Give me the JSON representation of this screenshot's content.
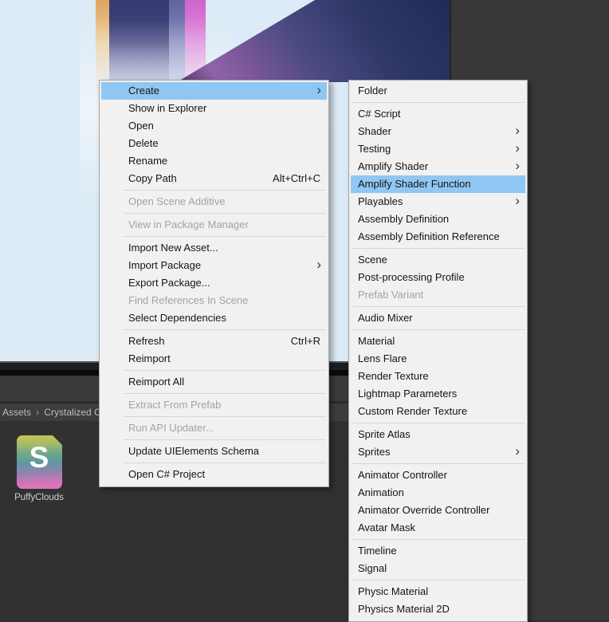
{
  "colors": {
    "scene_bg": "#dcebf6",
    "panel": "#383838",
    "menu_bg": "#f1f1f1",
    "menu_border": "#a5a5a5",
    "menu_text": "#141414",
    "menu_disabled": "#a3a3a3",
    "menu_sep": "#d7d7d7",
    "highlight": "#8fc7f2",
    "breadcrumb_bg": "#3d3d3d",
    "breadcrumb_text": "#bdbdbd",
    "project_bg": "#313131",
    "icon_yellow": "#c9c552",
    "icon_teal": "#5f98a1",
    "icon_pink": "#d873b8"
  },
  "project": {
    "breadcrumb_root": "Assets",
    "breadcrumb_separator": "›",
    "breadcrumb_folder": "Crystalized C",
    "asset": {
      "badge": "S",
      "label": "PuffyClouds"
    }
  },
  "menus": {
    "context": {
      "items": [
        {
          "label": "Create",
          "highlighted": true,
          "submenu": true
        },
        {
          "label": "Show in Explorer"
        },
        {
          "label": "Open"
        },
        {
          "label": "Delete"
        },
        {
          "label": "Rename"
        },
        {
          "label": "Copy Path",
          "shortcut": "Alt+Ctrl+C"
        },
        {
          "separator": true
        },
        {
          "label": "Open Scene Additive",
          "disabled": true
        },
        {
          "separator": true
        },
        {
          "label": "View in Package Manager",
          "disabled": true
        },
        {
          "separator": true
        },
        {
          "label": "Import New Asset..."
        },
        {
          "label": "Import Package",
          "submenu": true
        },
        {
          "label": "Export Package..."
        },
        {
          "label": "Find References In Scene",
          "disabled": true
        },
        {
          "label": "Select Dependencies"
        },
        {
          "separator": true
        },
        {
          "label": "Refresh",
          "shortcut": "Ctrl+R"
        },
        {
          "label": "Reimport"
        },
        {
          "separator": true
        },
        {
          "label": "Reimport All"
        },
        {
          "separator": true
        },
        {
          "label": "Extract From Prefab",
          "disabled": true
        },
        {
          "separator": true
        },
        {
          "label": "Run API Updater...",
          "disabled": true
        },
        {
          "separator": true
        },
        {
          "label": "Update UIElements Schema"
        },
        {
          "separator": true
        },
        {
          "label": "Open C# Project"
        }
      ]
    },
    "create_submenu": {
      "items": [
        {
          "label": "Folder"
        },
        {
          "separator": true
        },
        {
          "label": "C# Script"
        },
        {
          "label": "Shader",
          "submenu": true
        },
        {
          "label": "Testing",
          "submenu": true
        },
        {
          "label": "Amplify Shader",
          "submenu": true
        },
        {
          "label": "Amplify Shader Function",
          "highlighted": true
        },
        {
          "label": "Playables",
          "submenu": true
        },
        {
          "label": "Assembly Definition"
        },
        {
          "label": "Assembly Definition Reference"
        },
        {
          "separator": true
        },
        {
          "label": "Scene"
        },
        {
          "label": "Post-processing Profile"
        },
        {
          "label": "Prefab Variant",
          "disabled": true
        },
        {
          "separator": true
        },
        {
          "label": "Audio Mixer"
        },
        {
          "separator": true
        },
        {
          "label": "Material"
        },
        {
          "label": "Lens Flare"
        },
        {
          "label": "Render Texture"
        },
        {
          "label": "Lightmap Parameters"
        },
        {
          "label": "Custom Render Texture"
        },
        {
          "separator": true
        },
        {
          "label": "Sprite Atlas"
        },
        {
          "label": "Sprites",
          "submenu": true
        },
        {
          "separator": true
        },
        {
          "label": "Animator Controller"
        },
        {
          "label": "Animation"
        },
        {
          "label": "Animator Override Controller"
        },
        {
          "label": "Avatar Mask"
        },
        {
          "separator": true
        },
        {
          "label": "Timeline"
        },
        {
          "label": "Signal"
        },
        {
          "separator": true
        },
        {
          "label": "Physic Material"
        },
        {
          "label": "Physics Material 2D"
        }
      ]
    }
  },
  "icons": {
    "submenu_arrow": "›"
  }
}
